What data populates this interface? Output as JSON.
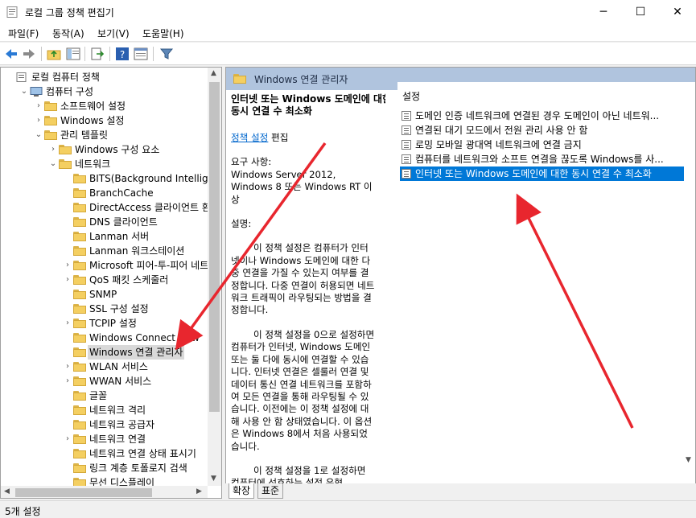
{
  "window": {
    "title": "로컬 그룹 정책 편집기",
    "minimize": "─",
    "maximize": "☐",
    "close": "✕"
  },
  "menu": [
    "파일(F)",
    "동작(A)",
    "보기(V)",
    "도움말(H)"
  ],
  "toolbar": {
    "icons": [
      "back-icon",
      "forward-icon",
      "up-folder-icon",
      "show-hide-tree-icon",
      "export-list-icon",
      "help-icon",
      "properties-icon",
      "filter-icon"
    ]
  },
  "tree": [
    {
      "label": "로컬 컴퓨터 정책",
      "level": 0,
      "expander": "",
      "icon": "policy"
    },
    {
      "label": "컴퓨터 구성",
      "level": 1,
      "expander": "⌄",
      "icon": "computer"
    },
    {
      "label": "소프트웨어 설정",
      "level": 2,
      "expander": "›",
      "icon": "folder"
    },
    {
      "label": "Windows 설정",
      "level": 2,
      "expander": "›",
      "icon": "folder"
    },
    {
      "label": "관리 템플릿",
      "level": 2,
      "expander": "⌄",
      "icon": "folder"
    },
    {
      "label": "Windows 구성 요소",
      "level": 3,
      "expander": "›",
      "icon": "folder"
    },
    {
      "label": "네트워크",
      "level": 3,
      "expander": "⌄",
      "icon": "folder"
    },
    {
      "label": "BITS(Background Intelligent Tr",
      "level": 4,
      "expander": "",
      "icon": "folder"
    },
    {
      "label": "BranchCache",
      "level": 4,
      "expander": "",
      "icon": "folder"
    },
    {
      "label": "DirectAccess 클라이언트 환경",
      "level": 4,
      "expander": "",
      "icon": "folder"
    },
    {
      "label": "DNS 클라이언트",
      "level": 4,
      "expander": "",
      "icon": "folder"
    },
    {
      "label": "Lanman 서버",
      "level": 4,
      "expander": "",
      "icon": "folder"
    },
    {
      "label": "Lanman 워크스테이션",
      "level": 4,
      "expander": "",
      "icon": "folder"
    },
    {
      "label": "Microsoft 피어-투-피어 네트",
      "level": 4,
      "expander": "›",
      "icon": "folder"
    },
    {
      "label": "QoS 패킷 스케줄러",
      "level": 4,
      "expander": "›",
      "icon": "folder"
    },
    {
      "label": "SNMP",
      "level": 4,
      "expander": "",
      "icon": "folder"
    },
    {
      "label": "SSL 구성 설정",
      "level": 4,
      "expander": "",
      "icon": "folder"
    },
    {
      "label": "TCPIP 설정",
      "level": 4,
      "expander": "›",
      "icon": "folder"
    },
    {
      "label": "Windows Connect Now",
      "level": 4,
      "expander": "",
      "icon": "folder"
    },
    {
      "label": "Windows 연결 관리자",
      "level": 4,
      "expander": "",
      "icon": "folder",
      "selected": true
    },
    {
      "label": "WLAN 서비스",
      "level": 4,
      "expander": "›",
      "icon": "folder"
    },
    {
      "label": "WWAN 서비스",
      "level": 4,
      "expander": "›",
      "icon": "folder"
    },
    {
      "label": "글꼴",
      "level": 4,
      "expander": "",
      "icon": "folder"
    },
    {
      "label": "네트워크 격리",
      "level": 4,
      "expander": "",
      "icon": "folder"
    },
    {
      "label": "네트워크 공급자",
      "level": 4,
      "expander": "",
      "icon": "folder"
    },
    {
      "label": "네트워크 연결",
      "level": 4,
      "expander": "›",
      "icon": "folder"
    },
    {
      "label": "네트워크 연결 상태 표시기",
      "level": 4,
      "expander": "",
      "icon": "folder"
    },
    {
      "label": "링크 계층 토폴로지 검색",
      "level": 4,
      "expander": "",
      "icon": "folder"
    },
    {
      "label": "무선 디스플레이",
      "level": 4,
      "expander": "",
      "icon": "folder"
    }
  ],
  "right": {
    "header": "Windows 연결 관리자",
    "desc_title": "인터넷 또는 Windows 도메인에 대한 동시 연결 수 최소화",
    "edit_link": "정책 설정",
    "edit_suffix": " 편집",
    "requirements_label": "요구 사항:",
    "requirements": "Windows Server 2012, Windows 8 또는 Windows RT 이상",
    "description_label": "설명:",
    "paragraphs": [
      "이 정책 설정은 컴퓨터가 인터넷이나 Windows 도메인에 대한 다중 연결을 가질 수 있는지 여부를 결정합니다. 다중 연결이 허용되면 네트워크 트래픽이 라우팅되는 방법을 결정합니다.",
      "이 정책 설정을 0으로 설정하면 컴퓨터가 인터넷, Windows 도메인 또는 둘 다에 동시에 연결할 수 있습니다. 인터넷 연결은 셀룰러 연결 및 데이터 통신 연결 네트워크를 포함하여 모든 연결을 통해 라우팅될 수 있습니다. 이전에는 이 정책 설정에 대해 사용 안 함 상태였습니다. 이 옵션은 Windows 8에서 처음 사용되었습니다.",
      "이 정책 설정을 1로 설정하면 컴퓨터에 선호하는 설정 유형"
    ],
    "list_header": "설정",
    "rows": [
      {
        "label": "도메인 인증 네트워크에 연결된 경우 도메인이 아닌 네트워...",
        "state": "구"
      },
      {
        "label": "연결된 대기 모드에서 전원 관리 사용 안 함",
        "state": "구"
      },
      {
        "label": "로밍 모바일 광대역 네트워크에 연결 금지",
        "state": "구"
      },
      {
        "label": "컴퓨터를 네트워크와 소프트 연결을 끊도록 Windows를 사...",
        "state": "구"
      },
      {
        "label": "인터넷 또는 Windows 도메인에 대한 동시 연결 수 최소화",
        "state": "구",
        "selected": true
      }
    ],
    "tabs": [
      "확장",
      "표준"
    ]
  },
  "status": "5개 설정",
  "colors": {
    "accent": "#0078d7",
    "header_band": "#b0c4de",
    "arrow": "#e8262e",
    "link": "#0066cc"
  }
}
